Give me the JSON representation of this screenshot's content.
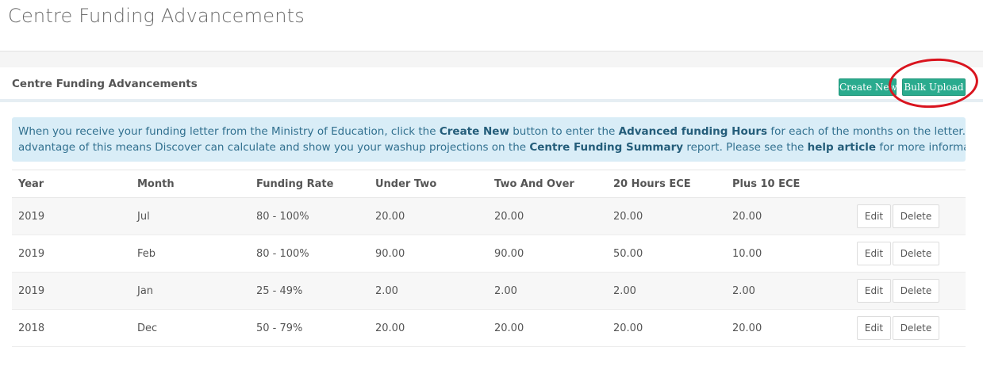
{
  "page": {
    "title": "Centre Funding Advancements"
  },
  "panel": {
    "title": "Centre Funding Advancements",
    "create_new_label": "Create New",
    "bulk_upload_label": "Bulk Upload"
  },
  "info": {
    "t1": "When you receive your funding letter from the Ministry of Education, click the ",
    "b1": "Create New",
    "t2": " button to enter the ",
    "b2": "Advanced funding Hours",
    "t3": " for each of the months on the letter. The",
    "t4": "advantage of this means Discover can calculate and show you your washup projections on the ",
    "b3": "Centre Funding Summary",
    "t5": " report. Please see the ",
    "link": "help article",
    "t6": " for more information."
  },
  "table": {
    "headers": [
      "Year",
      "Month",
      "Funding Rate",
      "Under Two",
      "Two And Over",
      "20 Hours ECE",
      "Plus 10 ECE"
    ],
    "edit_label": "Edit",
    "delete_label": "Delete",
    "rows": [
      [
        "2019",
        "Jul",
        "80 - 100%",
        "20.00",
        "20.00",
        "20.00",
        "20.00"
      ],
      [
        "2019",
        "Feb",
        "80 - 100%",
        "90.00",
        "90.00",
        "50.00",
        "10.00"
      ],
      [
        "2019",
        "Jan",
        "25 - 49%",
        "2.00",
        "2.00",
        "2.00",
        "2.00"
      ],
      [
        "2018",
        "Dec",
        "50 - 79%",
        "20.00",
        "20.00",
        "20.00",
        "20.00"
      ]
    ]
  },
  "colors": {
    "accent": "#2aab8e",
    "info_bg": "#d9edf7",
    "info_text": "#31708f",
    "highlight": "#d9141e"
  }
}
